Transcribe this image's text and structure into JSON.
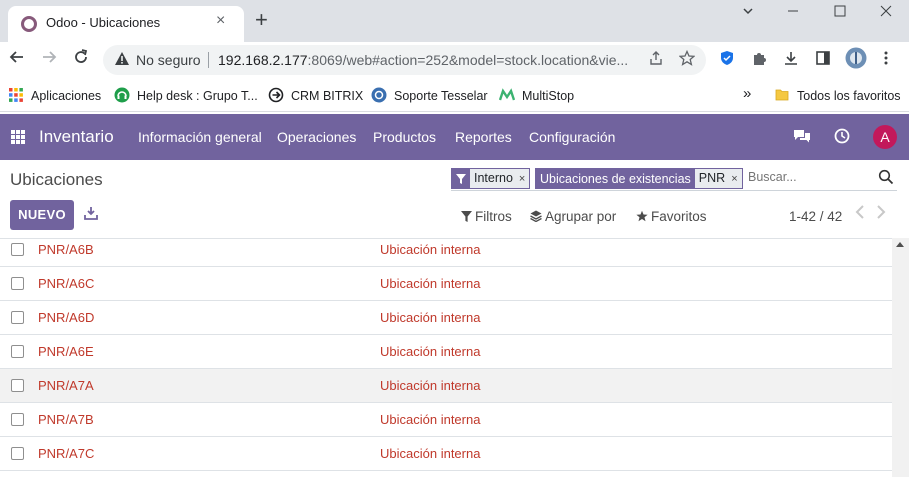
{
  "browser": {
    "tab_title": "Odoo - Ubicaciones",
    "tab_close": "×",
    "new_tab": "+",
    "not_secure": "No seguro",
    "url_host": "192.168.2.177",
    "url_rest": ":8069/web#action=252&model=stock.location&vie..."
  },
  "bookmarks": {
    "items": [
      {
        "label": "Aplicaciones"
      },
      {
        "label": "Help desk : Grupo T..."
      },
      {
        "label": "CRM BITRIX"
      },
      {
        "label": "Soporte Tesselar"
      },
      {
        "label": "MultiStop"
      }
    ],
    "more": "»",
    "all_favorites": "Todos los favoritos"
  },
  "navbar": {
    "brand": "Inventario",
    "menus": [
      "Información general",
      "Operaciones",
      "Productos",
      "Reportes",
      "Configuración"
    ],
    "avatar_letter": "A",
    "color": "#71639e"
  },
  "control_panel": {
    "breadcrumb": "Ubicaciones",
    "facets": [
      {
        "value": "Interno"
      },
      {
        "label": "Ubicaciones de existencias",
        "value": "PNR"
      }
    ],
    "facet_remove": "×",
    "search_placeholder": "Buscar...",
    "new_button": "NUEVO",
    "filters": "Filtros",
    "group_by": "Agrupar por",
    "favorites": "Favoritos",
    "pager": "1-42 / 42"
  },
  "list": {
    "rows": [
      {
        "name": "PNR/A6B",
        "type": "Ubicación interna"
      },
      {
        "name": "PNR/A6C",
        "type": "Ubicación interna"
      },
      {
        "name": "PNR/A6D",
        "type": "Ubicación interna"
      },
      {
        "name": "PNR/A6E",
        "type": "Ubicación interna"
      },
      {
        "name": "PNR/A7A",
        "type": "Ubicación interna"
      },
      {
        "name": "PNR/A7B",
        "type": "Ubicación interna"
      },
      {
        "name": "PNR/A7C",
        "type": "Ubicación interna"
      }
    ],
    "text_color": "#c0392b"
  }
}
